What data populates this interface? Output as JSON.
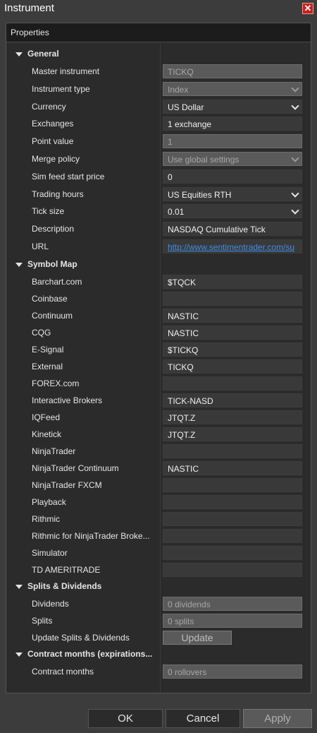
{
  "window": {
    "title": "Instrument",
    "close_label": "✕"
  },
  "panel": {
    "header": "Properties"
  },
  "categories": {
    "general": "General",
    "symbol_map": "Symbol Map",
    "splits": "Splits & Dividends",
    "contract": "Contract months (expirations..."
  },
  "general": [
    {
      "label": "Master instrument",
      "value": "TICKQ",
      "disabled": true,
      "dropdown": false
    },
    {
      "label": "Instrument type",
      "value": "Index",
      "disabled": true,
      "dropdown": true
    },
    {
      "label": "Currency",
      "value": "US Dollar",
      "disabled": false,
      "dropdown": true
    },
    {
      "label": "Exchanges",
      "value": "1 exchange",
      "disabled": false,
      "dropdown": false
    },
    {
      "label": "Point value",
      "value": "1",
      "disabled": true,
      "dropdown": false
    },
    {
      "label": "Merge policy",
      "value": "Use global settings",
      "disabled": true,
      "dropdown": true
    },
    {
      "label": "Sim feed start price",
      "value": "0",
      "disabled": false,
      "dropdown": false
    },
    {
      "label": "Trading hours",
      "value": "US Equities RTH",
      "disabled": false,
      "dropdown": true
    },
    {
      "label": "Tick size",
      "value": "0.01",
      "disabled": false,
      "dropdown": true
    },
    {
      "label": "Description",
      "value": "NASDAQ Cumulative Tick",
      "disabled": false,
      "dropdown": false
    },
    {
      "label": "URL",
      "value": "http://www.sentimentrader.com/su",
      "disabled": false,
      "dropdown": false,
      "link": true
    }
  ],
  "symbol_map": [
    {
      "label": "Barchart.com",
      "value": "$TQCK"
    },
    {
      "label": "Coinbase",
      "value": ""
    },
    {
      "label": "Continuum",
      "value": "NASTIC"
    },
    {
      "label": "CQG",
      "value": "NASTIC"
    },
    {
      "label": "E-Signal",
      "value": "$TICKQ"
    },
    {
      "label": "External",
      "value": "TICKQ"
    },
    {
      "label": "FOREX.com",
      "value": ""
    },
    {
      "label": "Interactive Brokers",
      "value": "TICK-NASD"
    },
    {
      "label": "IQFeed",
      "value": "JTQT.Z"
    },
    {
      "label": "Kinetick",
      "value": "JTQT.Z"
    },
    {
      "label": "NinjaTrader",
      "value": ""
    },
    {
      "label": "NinjaTrader Continuum",
      "value": "NASTIC"
    },
    {
      "label": "NinjaTrader FXCM",
      "value": ""
    },
    {
      "label": "Playback",
      "value": ""
    },
    {
      "label": "Rithmic",
      "value": ""
    },
    {
      "label": "Rithmic for NinjaTrader Broke...",
      "value": ""
    },
    {
      "label": "Simulator",
      "value": ""
    },
    {
      "label": "TD AMERITRADE",
      "value": ""
    }
  ],
  "splits": {
    "dividends_label": "Dividends",
    "dividends_value": "0 dividends",
    "splits_label": "Splits",
    "splits_value": "0 splits",
    "update_label": "Update Splits & Dividends",
    "update_button": "Update"
  },
  "contract": {
    "label": "Contract months",
    "value": "0 rollovers"
  },
  "footer": {
    "ok": "OK",
    "cancel": "Cancel",
    "apply": "Apply"
  }
}
